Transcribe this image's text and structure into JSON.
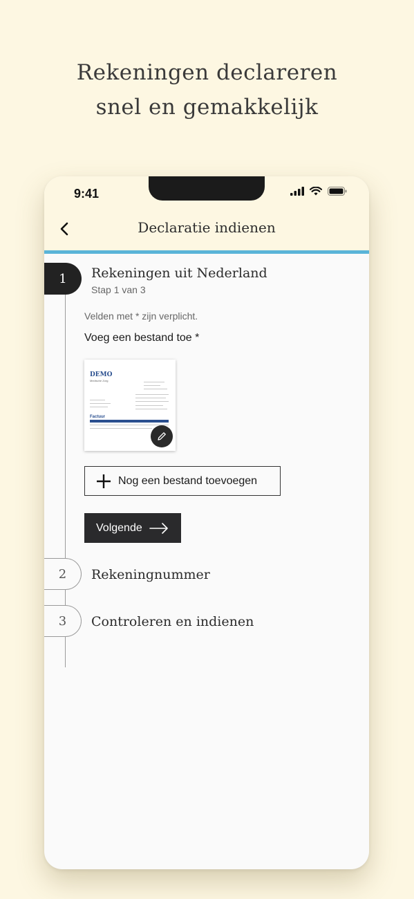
{
  "headline": {
    "line1": "Rekeningen declareren",
    "line2": "snel en gemakkelijk"
  },
  "status_bar": {
    "time": "9:41",
    "icons": [
      "signal-icon",
      "wifi-icon",
      "battery-icon"
    ]
  },
  "nav": {
    "title": "Declaratie indienen",
    "back_icon": "chevron-left-icon"
  },
  "colors": {
    "background": "#fdf7e2",
    "accent": "#5ab4d8",
    "active_step": "#222222",
    "primary_button": "#2a2a2c"
  },
  "steps": [
    {
      "number": "1",
      "title": "Rekeningen uit Nederland",
      "subtitle": "Stap 1 van 3",
      "state": "active"
    },
    {
      "number": "2",
      "title": "Rekeningnummer",
      "state": "inactive"
    },
    {
      "number": "3",
      "title": "Controleren en indienen",
      "state": "inactive"
    }
  ],
  "form": {
    "required_note": "Velden met * zijn verplicht.",
    "file_label": "Voeg een bestand toe *",
    "thumbnail": {
      "brand": "DEMO",
      "brand_sub": "Medische Zorg",
      "doc_heading": "Factuur"
    },
    "add_file_label": "Nog een bestand toevoegen",
    "next_label": "Volgende"
  }
}
